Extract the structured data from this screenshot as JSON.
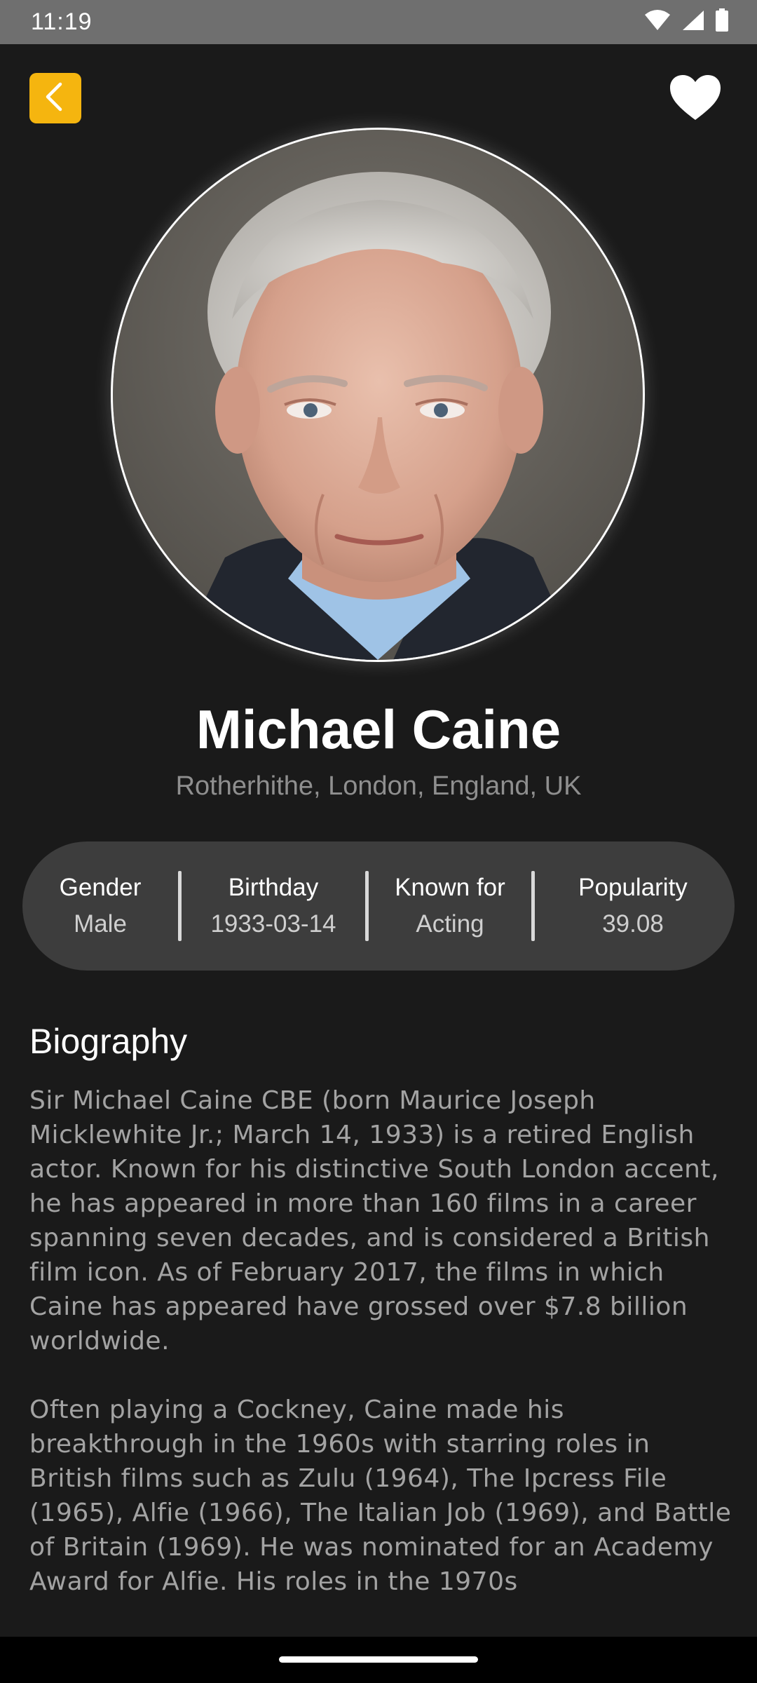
{
  "status_bar": {
    "time": "11:19",
    "icons": [
      "wifi-icon",
      "signal-icon",
      "battery-icon"
    ]
  },
  "header": {
    "back_icon": "chevron-left-icon",
    "favorite_icon": "heart-icon",
    "accent_color": "#f5b50f"
  },
  "profile": {
    "name": "Michael Caine",
    "birthplace": "Rotherhithe, London, England, UK"
  },
  "stats": [
    {
      "label": "Gender",
      "value": "Male"
    },
    {
      "label": "Birthday",
      "value": "1933-03-14"
    },
    {
      "label": "Known for",
      "value": "Acting"
    },
    {
      "label": "Popularity",
      "value": "39.08"
    }
  ],
  "biography": {
    "heading": "Biography",
    "paragraphs": [
      "Sir Michael Caine CBE (born Maurice Joseph Micklewhite Jr.; March 14, 1933) is a retired English actor. Known for his distinctive South London accent, he has appeared in more than 160 films in a career spanning seven decades, and is considered a British film icon. As of February 2017, the films in which Caine has appeared have grossed over $7.8 billion worldwide.",
      "Often playing a Cockney, Caine made his breakthrough in the 1960s with starring roles in British films such as Zulu (1964), The Ipcress File (1965), Alfie (1966), The Italian Job (1969), and Battle of Britain (1969). He was nominated for an Academy Award for Alfie. His roles in the 1970s"
    ]
  }
}
